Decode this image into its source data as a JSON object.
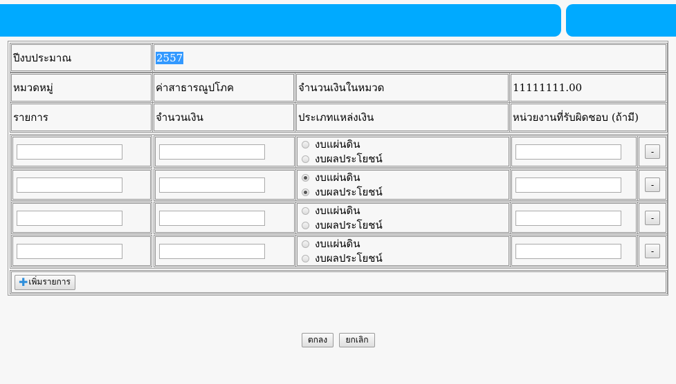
{
  "form": {
    "fiscal_year_label": "ปีงบประมาณ",
    "fiscal_year_value": "2557",
    "category_label": "หมวดหมู่",
    "category_value": "ค่าสาธารณูปโภค",
    "category_amount_label": "จำนวนเงินในหมวด",
    "category_amount_value": "11111111.00",
    "col_item": "รายการ",
    "col_amount": "จำนวนเงิน",
    "col_funding_type": "ประเภทแหล่งเงิน",
    "col_responsible_unit": "หน่วยงานที่รับผิดชอบ (ถ้ามี)"
  },
  "funding_options": [
    "งบแผ่นดิน",
    "งบผลประโยชน์"
  ],
  "rows": [
    {
      "item": "",
      "amount": "",
      "unit": "",
      "funding_selected": [
        false,
        false
      ]
    },
    {
      "item": "",
      "amount": "",
      "unit": "",
      "funding_selected": [
        true,
        true
      ]
    },
    {
      "item": "",
      "amount": "",
      "unit": "",
      "funding_selected": [
        false,
        false
      ]
    },
    {
      "item": "",
      "amount": "",
      "unit": "",
      "funding_selected": [
        false,
        false
      ]
    }
  ],
  "buttons": {
    "remove_row": "-",
    "add_item": "เพิ่มรายการ",
    "ok": "ตกลง",
    "cancel": "ยกเลิก"
  },
  "icons": {
    "add": "plus-icon"
  },
  "colors": {
    "header_bar": "#00aaff",
    "selection": "#3399ff"
  }
}
